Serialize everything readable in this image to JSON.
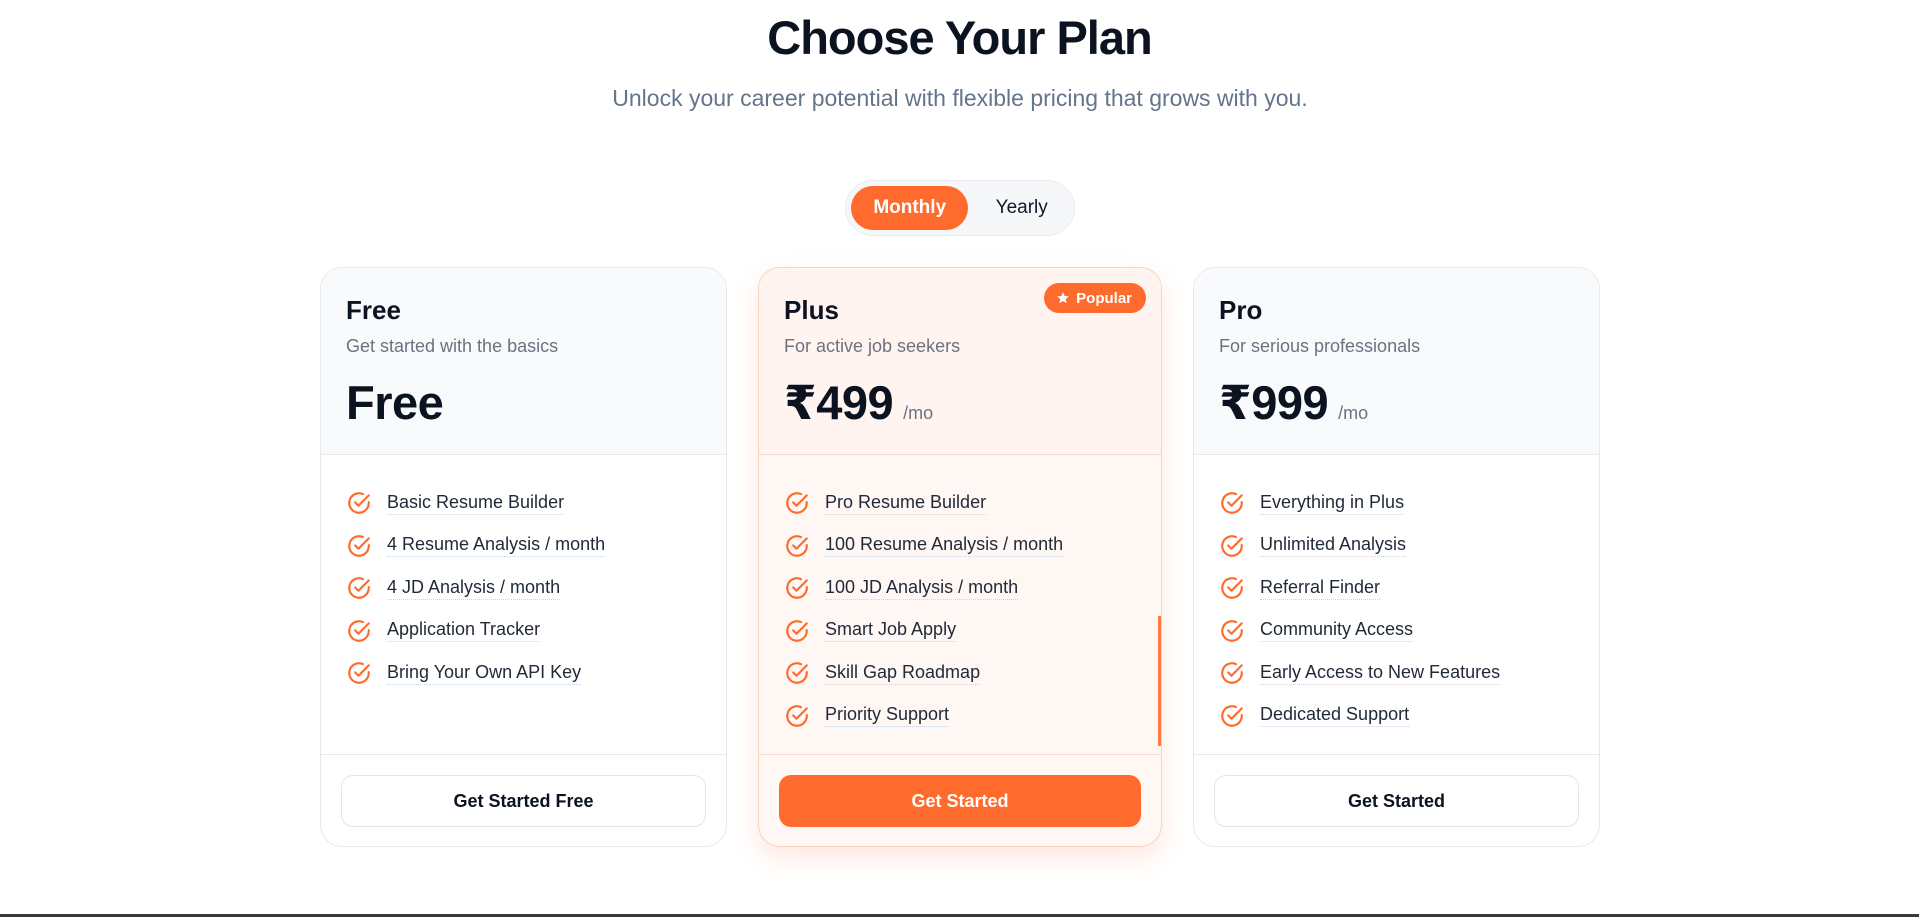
{
  "header": {
    "title": "Choose Your Plan",
    "subtitle": "Unlock your career potential with flexible pricing that grows with you."
  },
  "billing_toggle": {
    "options": [
      "Monthly",
      "Yearly"
    ],
    "selected": "Monthly"
  },
  "colors": {
    "accent": "#ff6b2c",
    "text": "#0b1220",
    "muted": "#6b7280"
  },
  "plans": [
    {
      "name": "Free",
      "description": "Get started with the basics",
      "price": "Free",
      "period": "",
      "badge": "",
      "features": [
        "Basic Resume Builder",
        "4 Resume Analysis / month",
        "4 JD Analysis / month",
        "Application Tracker",
        "Bring Your Own API Key"
      ],
      "cta": "Get Started Free"
    },
    {
      "name": "Plus",
      "description": "For active job seekers",
      "price": "₹499",
      "period": "/mo",
      "badge": "Popular",
      "badge_icon": "star-icon",
      "features": [
        "Pro Resume Builder",
        "100 Resume Analysis / month",
        "100 JD Analysis / month",
        "Smart Job Apply",
        "Skill Gap Roadmap",
        "Priority Support"
      ],
      "cta": "Get Started"
    },
    {
      "name": "Pro",
      "description": "For serious professionals",
      "price": "₹999",
      "period": "/mo",
      "badge": "",
      "features": [
        "Everything in Plus",
        "Unlimited Analysis",
        "Referral Finder",
        "Community Access",
        "Early Access to New Features",
        "Dedicated Support"
      ],
      "cta": "Get Started"
    }
  ],
  "feature_icon": "check-circle-icon"
}
